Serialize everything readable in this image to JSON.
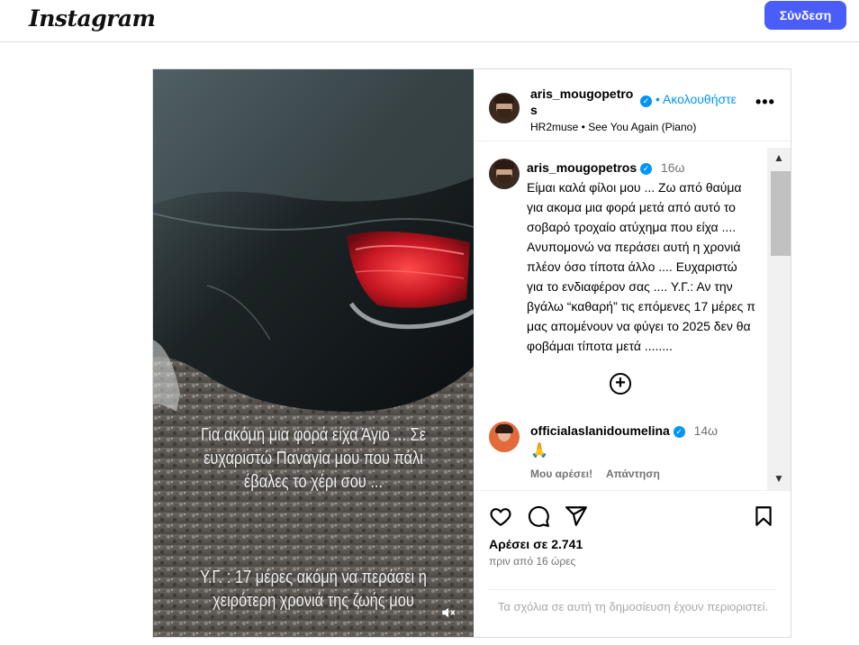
{
  "topbar": {
    "logo": "Instagram",
    "login_label": "Σύνδεση"
  },
  "post": {
    "author": {
      "username_line1": "aris_mougopetro",
      "username_line2": "s",
      "verified": true,
      "follow_label": "• Ακολουθήστε",
      "audio": "HR2muse • See You Again (Piano)"
    },
    "media": {
      "overlay_line1": "Για ακόμη μια φορά είχα Άγιο ... Σε",
      "overlay_line2": "ευχαριστώ Παναγία μου που πάλι",
      "overlay_line3": "έβαλες το χέρι σου ...",
      "overlay_line4": "Υ.Γ. : 17 μέρες ακόμη να περάσει η",
      "overlay_line5": "χειρότερη χρονιά της ζωής μου",
      "mute_icon": "speaker-muted-icon"
    },
    "caption": {
      "username": "aris_mougopetros",
      "time": "16ω",
      "text": "Είμαι καλά φίλοι μου ... Ζω από θαύμα για ακομα μια φορά μετά από αυτό το σοβαρό τροχαίο ατύχημα που είχα .... Ανυπομονώ να περάσει αυτή η χρονιά πλέον όσο τίποτα άλλο .... Ευχαριστώ για το ενδιαφέρον σας .... Υ.Γ.: Αν την βγάλω “καθαρή” τις επόμενες 17 μέρες π μας απομένουν να φύγει το 2025 δεν θα  φοβάμαι τίποτα μετά ........"
    },
    "more_comments_icon": "plus-circle-icon",
    "comment": {
      "username": "officialaslanidoumelina",
      "time": "14ω",
      "text": "🙏",
      "like_label": "Μου αρέσει!",
      "reply_label": "Απάντηση"
    },
    "likes": "Αρέσει σε 2.741",
    "posted_ago": "πριν από 16 ώρες",
    "comments_limited": "Τα σχόλια σε αυτή τη δημοσίευση έχουν περιοριστεί.",
    "colors": {
      "accent": "#0095f6",
      "login_button": "#4a5df9",
      "muted_text": "#737373"
    }
  }
}
